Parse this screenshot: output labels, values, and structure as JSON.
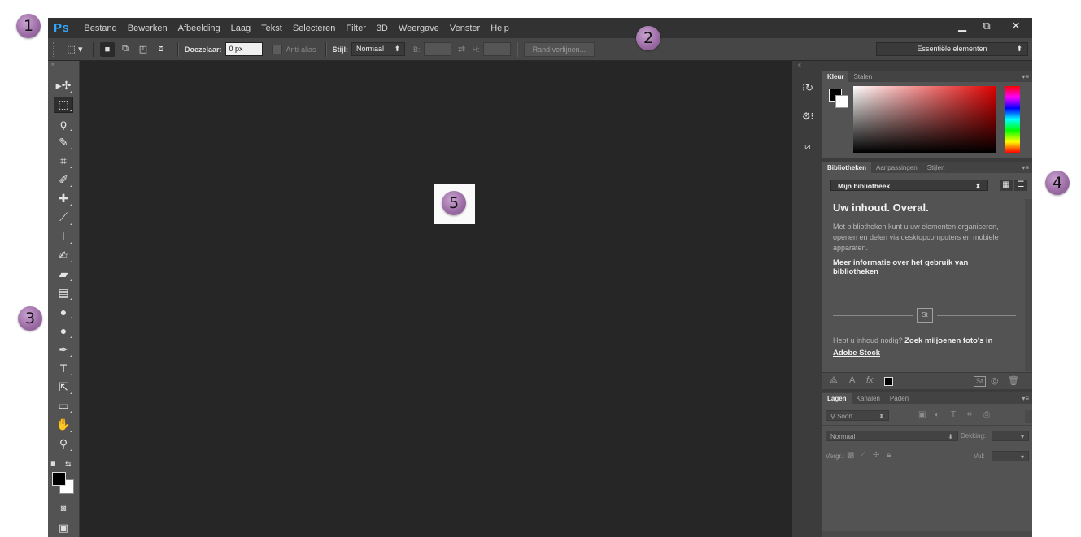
{
  "app": {
    "logo": "Ps"
  },
  "menu": [
    "Bestand",
    "Bewerken",
    "Afbeelding",
    "Laag",
    "Tekst",
    "Selecteren",
    "Filter",
    "3D",
    "Weergave",
    "Venster",
    "Help"
  ],
  "window_buttons": {
    "minimize": "▁",
    "restore": "⧉",
    "close": "✕"
  },
  "options_bar": {
    "feather_label": "Doezelaar:",
    "feather_value": "0 px",
    "antialias_label": "Anti-alias",
    "style_label": "Stijl:",
    "style_value": "Normaal",
    "width_label": "B:",
    "height_label": "H:",
    "refine_button": "Rand verfijnen...",
    "workspace": "Essentiële elementen"
  },
  "tools": [
    "move-icon",
    "marquee-icon",
    "lasso-icon",
    "quick-selection-icon",
    "crop-icon",
    "eyedropper-icon",
    "healing-brush-icon",
    "brush-icon",
    "clone-stamp-icon",
    "history-brush-icon",
    "eraser-icon",
    "gradient-icon",
    "blur-icon",
    "dodge-icon",
    "pen-icon",
    "type-icon",
    "path-selection-icon",
    "rectangle-icon",
    "hand-icon",
    "zoom-icon"
  ],
  "tool_glyphs": [
    "▸✢",
    "⬚",
    "ϙ",
    "✎",
    "⌗",
    "✐",
    "✚",
    "⟋",
    "⊥",
    "✍",
    "▰",
    "▤",
    "●",
    "●",
    "✒",
    "T",
    "⇱",
    "▭",
    "✋",
    "⚲"
  ],
  "color_panel": {
    "tabs": [
      "Kleur",
      "Stalen"
    ]
  },
  "libraries_panel": {
    "tabs": [
      "Bibliotheken",
      "Aanpassingen",
      "Stijlen"
    ],
    "library": "Mijn bibliotheek",
    "heading": "Uw inhoud. Overal.",
    "description": "Met bibliotheken kunt u uw elementen organiseren, openen en delen via desktopcomputers en mobiele apparaten.",
    "link": "Meer informatie over het gebruik van bibliotheken",
    "stock_logo": "St",
    "stock_prompt": "Hebt u inhoud nodig?",
    "stock_link": "Zoek miljoenen foto's in Adobe Stock"
  },
  "layers_panel": {
    "tabs": [
      "Lagen",
      "Kanalen",
      "Paden"
    ],
    "filter": "Soort",
    "blend_mode": "Normaal",
    "opacity_label": "Dekking:",
    "lock_label": "Vergr.:",
    "fill_label": "Vul:"
  },
  "callouts": [
    "1",
    "2",
    "3",
    "4",
    "5"
  ],
  "colors": {
    "accent": "#31a8ff",
    "callout": "#9a6aa3",
    "canvas": "#262626",
    "panel": "#535353"
  }
}
